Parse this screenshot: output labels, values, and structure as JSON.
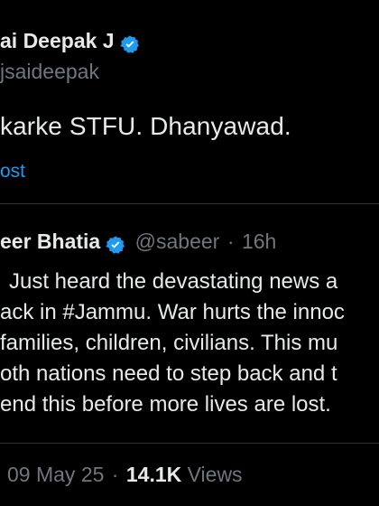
{
  "author": {
    "name": "ai Deepak J",
    "handle": "jsaideepak",
    "verified_icon": "verified-badge-icon",
    "badge_color": "#1d9bf0"
  },
  "tweet": {
    "text": "karke STFU. Dhanyawad.",
    "translate_link": "ost"
  },
  "quoted": {
    "name": "eer Bhatia",
    "handle": "@sabeer",
    "separator": "·",
    "age": "16h",
    "lines": [
      "Just heard the devastating news a",
      "ack in #Jammu. War hurts the innoc",
      "families, children, civilians. This mu",
      "oth nations need to step back and t",
      "end this before more lives are lost."
    ]
  },
  "meta": {
    "date": "09 May 25",
    "separator": "·",
    "views_count": "14.1K",
    "views_label": "Views"
  },
  "colors": {
    "background": "#000000",
    "text": "#e7e9ea",
    "muted": "#71767b",
    "accent": "#1d9bf0",
    "border": "#2f3336"
  }
}
